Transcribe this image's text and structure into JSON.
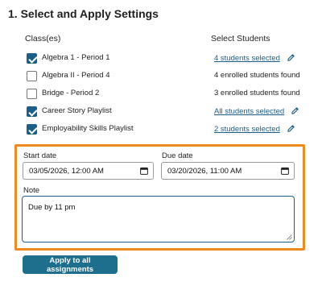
{
  "section": {
    "title": "1. Select and Apply Settings"
  },
  "columns": {
    "classes": "Class(es)",
    "students": "Select Students"
  },
  "rows": [
    {
      "label": "Algebra 1 - Period 1",
      "checked": true,
      "students": "4 students selected",
      "link": true
    },
    {
      "label": "Algebra II - Period 4",
      "checked": false,
      "students": "4 enrolled students found",
      "link": false
    },
    {
      "label": "Bridge - Period 2",
      "checked": false,
      "students": "3 enrolled students found",
      "link": false
    },
    {
      "label": "Career Story Playlist",
      "checked": true,
      "students": "All students selected",
      "link": true
    },
    {
      "label": "Employability Skills Playlist",
      "checked": true,
      "students": "2 students selected",
      "link": true
    }
  ],
  "dates": {
    "start_label": "Start date",
    "start_value": "03/05/2026, 12:00 AM",
    "due_label": "Due date",
    "due_value": "03/20/2026, 11:00 AM"
  },
  "note": {
    "label": "Note",
    "value": "Due by 11 pm"
  },
  "apply_button": {
    "label": "Apply to all assignments"
  },
  "colors": {
    "accent": "#1a5e8a",
    "highlight_border": "#f08a1c",
    "button": "#1e6e8e"
  },
  "icons": {
    "edit": "pencil-icon",
    "calendar": "calendar-icon"
  }
}
